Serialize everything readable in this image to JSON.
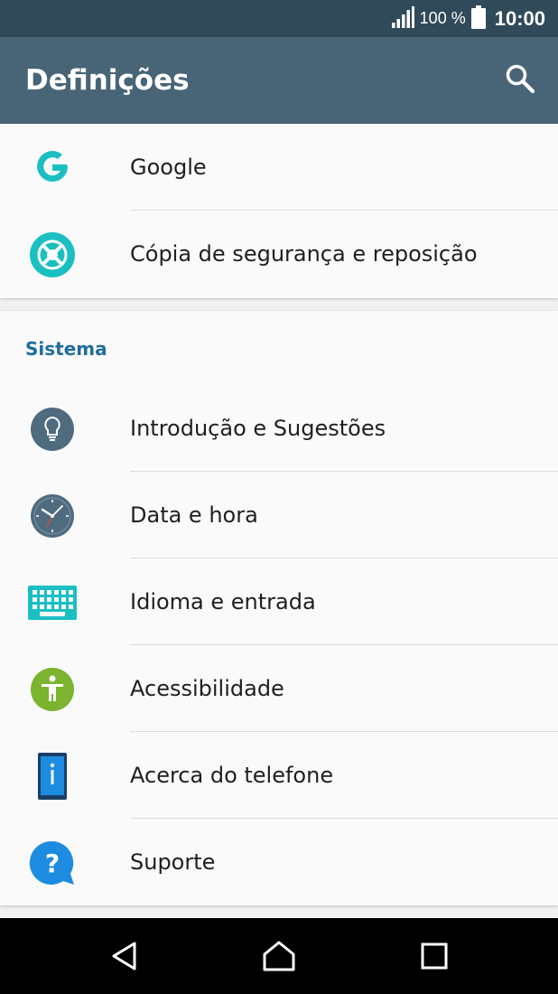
{
  "status_bar": {
    "battery_percent": "100 %",
    "time": "10:00"
  },
  "app_bar": {
    "title": "Definições"
  },
  "top_items": [
    {
      "label": "Google",
      "icon": "google-icon"
    },
    {
      "label": "Cópia de segurança e reposição",
      "icon": "backup-reset-icon"
    }
  ],
  "system_section": {
    "header": "Sistema",
    "items": [
      {
        "label": "Introdução e Sugestões",
        "icon": "lightbulb-icon"
      },
      {
        "label": "Data e hora",
        "icon": "clock-icon"
      },
      {
        "label": "Idioma e entrada",
        "icon": "keyboard-icon"
      },
      {
        "label": "Acessibilidade",
        "icon": "accessibility-icon"
      },
      {
        "label": "Acerca do telefone",
        "icon": "phone-info-icon"
      },
      {
        "label": "Suporte",
        "icon": "support-icon"
      }
    ]
  },
  "colors": {
    "status_bar": "#304a5a",
    "app_bar": "#476577",
    "section_header": "#1f6e9e",
    "teal": "#1bbfc2",
    "slate": "#4f6b7e",
    "green": "#7cb32f",
    "blue": "#1d8ce0"
  }
}
